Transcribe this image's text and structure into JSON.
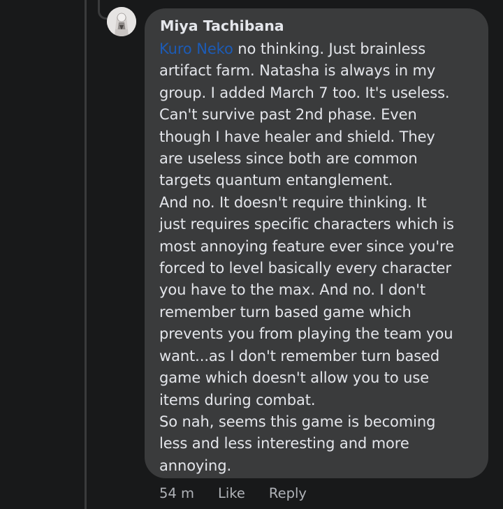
{
  "comment": {
    "author": "Miya Tachibana",
    "mention": "Kuro Neko",
    "lines": [
      " no thinking. Just brainless",
      "artifact farm. Natasha is always in my",
      "group. I added March 7 too. It's useless.",
      "Can't survive past 2nd phase. Even",
      "though I have healer and shield. They",
      "are useless since both are common",
      "targets quantum entanglement.",
      "And no. It doesn't require thinking. It",
      "just requires specific characters which is",
      "most annoying feature ever since you're",
      "forced to level basically every character",
      "you have to the max. And no. I don't",
      "remember turn based game which",
      "prevents you from playing the team you",
      "want...as I don't remember turn based",
      "game which doesn't allow you to use",
      "items during combat.",
      "So nah, seems this game is becoming",
      "less and less interesting and more",
      "annoying."
    ]
  },
  "actions": {
    "timestamp": "54 m",
    "like_label": "Like",
    "reply_label": "Reply"
  },
  "icons": {
    "avatar": "user-avatar-icon"
  },
  "colors": {
    "background": "#18191a",
    "bubble": "#3a3b3c",
    "text": "#e4e6eb",
    "mention": "#1c5bb6",
    "meta": "#b0b3b8"
  }
}
